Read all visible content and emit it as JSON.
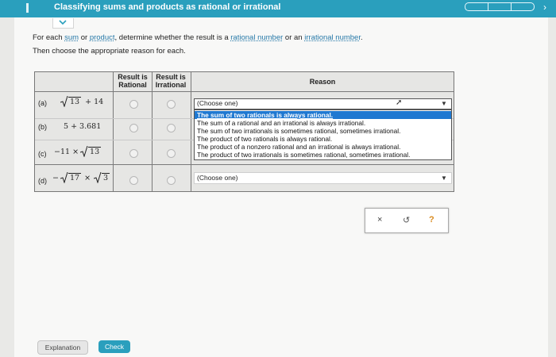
{
  "header": {
    "title": "Classifying sums and products as rational or irrational",
    "menu_icon": "hamburger-icon",
    "progress_segments": 3
  },
  "instructions": {
    "line1": {
      "part1": "For each ",
      "link1": "sum",
      "part2": " or ",
      "link2": "product",
      "part3": ", determine whether the result is a ",
      "link3": "rational number",
      "part4": " or an ",
      "link4": "irrational number",
      "part5": "."
    },
    "line2": "Then choose the appropriate reason for each."
  },
  "table": {
    "col_rational": [
      "Result is",
      "Rational"
    ],
    "col_irrational": [
      "Result is",
      "Irrational"
    ],
    "col_reason": "Reason",
    "rows": [
      {
        "label": "(a)",
        "expr": {
          "r1": "13",
          "op": "+ 14"
        }
      },
      {
        "label": "(b)",
        "expr": {
          "text": "5 + 3.681"
        }
      },
      {
        "label": "(c)",
        "expr": {
          "pre": "−11 ×",
          "r1": "13"
        }
      },
      {
        "label": "(d)",
        "expr": {
          "pre": "−",
          "r1": "17",
          "op": "×",
          "r2": "3"
        }
      }
    ]
  },
  "dropdown_a": {
    "placeholder": "(Choose one)",
    "options": [
      "The sum of two rationals is always rational.",
      "The sum of a rational and an irrational is always irrational.",
      "The sum of two irrationals is sometimes rational, sometimes irrational.",
      "The product of two rationals is always rational.",
      "The product of a nonzero rational and an irrational is always irrational.",
      "The product of two irrationals is sometimes rational, sometimes irrational."
    ],
    "highlighted_index": 0
  },
  "dropdown_d": {
    "placeholder": "(Choose one)"
  },
  "actions": {
    "clear": "×",
    "undo": "↺",
    "help": "?"
  },
  "footer": {
    "explanation": "Explanation",
    "check": "Check"
  },
  "colors": {
    "brand": "#2a9fbd",
    "highlight": "#1f78d1",
    "help": "#d98a1e"
  }
}
